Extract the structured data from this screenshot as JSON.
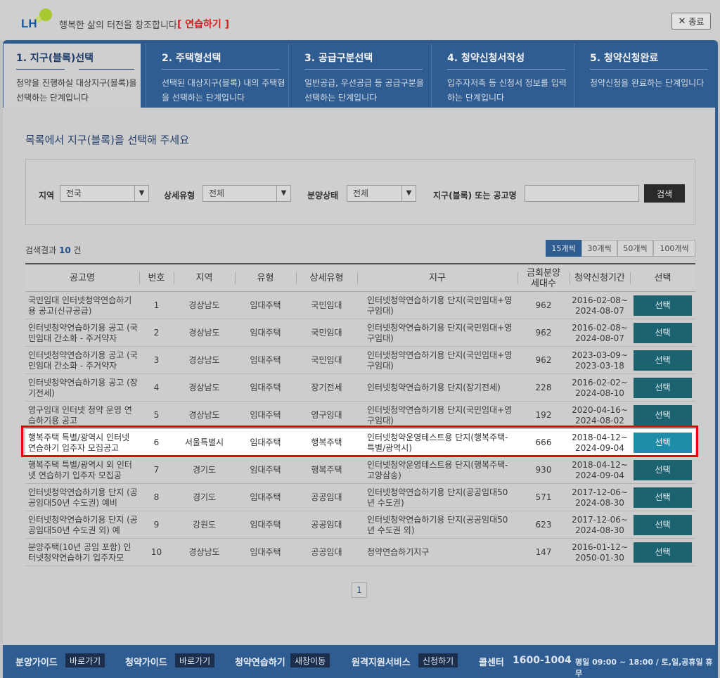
{
  "header": {
    "logo_text": "LH",
    "slogan": "행복한 삶의 터전을 창조합니다.",
    "practice_label": "[ 연습하기 ]",
    "close_label": "종료"
  },
  "steps": [
    {
      "title": "1. 지구(블록)선택",
      "desc": "청약을 진행하실 대상지구(블록)을 선택하는 단계입니다"
    },
    {
      "title": "2. 주택형선택",
      "desc": "선택된 대상지구(블록) 내의 주택형을 선택하는 단계입니다"
    },
    {
      "title": "3. 공급구분선택",
      "desc": "일반공급, 우선공급 등 공급구분을 선택하는 단계입니다"
    },
    {
      "title": "4. 청약신청서작성",
      "desc": "입주자저축 등 신청서 정보를 입력하는 단계입니다"
    },
    {
      "title": "5. 청약신청완료",
      "desc": "청약신청을 완료하는 단계입니다"
    }
  ],
  "main": {
    "heading": "목록에서 지구(블록)을 선택해 주세요"
  },
  "filters": {
    "region_label": "지역",
    "region_value": "전국",
    "detail_type_label": "상세유형",
    "detail_type_value": "전체",
    "sale_status_label": "분양상태",
    "sale_status_value": "전체",
    "keyword_label": "지구(블록) 또는 공고명",
    "keyword_value": "",
    "search_label": "검색"
  },
  "results": {
    "prefix": "검색결과",
    "count": "10",
    "suffix": "건"
  },
  "page_sizes": [
    "15개씩",
    "30개씩",
    "50개씩",
    "100개씩"
  ],
  "table": {
    "headers": [
      "공고명",
      "번호",
      "지역",
      "유형",
      "상세유형",
      "지구",
      "금회분양 세대수",
      "청약신청기간",
      "선택"
    ],
    "rows": [
      {
        "title": "국민임대 인터넷청약연습하기용 공고(신규공급)",
        "no": "1",
        "region": "경상남도",
        "type": "임대주택",
        "detail": "국민임대",
        "district": "인터넷청약연습하기용 단지(국민임대+영구임대)",
        "units": "962",
        "period": "2016-02-08~ 2024-08-07",
        "btn": "선택"
      },
      {
        "title": "인터넷청약연습하기용 공고 (국민임대 간소화 - 주거약자",
        "no": "2",
        "region": "경상남도",
        "type": "임대주택",
        "detail": "국민임대",
        "district": "인터넷청약연습하기용 단지(국민임대+영구임대)",
        "units": "962",
        "period": "2016-02-08~ 2024-08-07",
        "btn": "선택"
      },
      {
        "title": " 인터넷청약연습하기용 공고 (국민임대 간소화 - 주거약자",
        "no": "3",
        "region": "경상남도",
        "type": "임대주택",
        "detail": "국민임대",
        "district": "인터넷청약연습하기용 단지(국민임대+영구임대)",
        "units": "962",
        "period": "2023-03-09~ 2023-03-18",
        "btn": "선택"
      },
      {
        "title": "인터넷청약연습하기용 공고 (장기전세)",
        "no": "4",
        "region": "경상남도",
        "type": "임대주택",
        "detail": "장기전세",
        "district": "인터넷청약연습하기용 단지(장기전세)",
        "units": "228",
        "period": "2016-02-02~ 2024-08-10",
        "btn": "선택"
      },
      {
        "title": "영구임대 인터넷 청약 운영 연습하기용 공고",
        "no": "5",
        "region": "경상남도",
        "type": "임대주택",
        "detail": "영구임대",
        "district": "인터넷청약연습하기용 단지(국민임대+영구임대)",
        "units": "192",
        "period": "2020-04-16~ 2024-08-02",
        "btn": "선택"
      },
      {
        "title": "행복주택 특별/광역시 인터넷 연습하기 입주자 모집공고",
        "no": "6",
        "region": "서울특별시",
        "type": "임대주택",
        "detail": "행복주택",
        "district": "인터넷청약운영테스트용 단지(행복주택-특별/광역시)",
        "units": "666",
        "period": "2018-04-12~ 2024-09-04",
        "btn": "선택"
      },
      {
        "title": "행복주택 특별/광역시 외 인터넷 연습하기 입주자 모집공",
        "no": "7",
        "region": "경기도",
        "type": "임대주택",
        "detail": "행복주택",
        "district": "인터넷청약운영테스트용 단지(행복주택-고양삼송)",
        "units": "930",
        "period": "2018-04-12~ 2024-09-04",
        "btn": "선택"
      },
      {
        "title": "인터넷청약연습하기용 단지 (공공임대50년 수도권) 예비",
        "no": "8",
        "region": "경기도",
        "type": "임대주택",
        "detail": "공공임대",
        "district": "인터넷청약연습하기용 단지(공공임대50년 수도권)",
        "units": "571",
        "period": "2017-12-06~ 2024-08-30",
        "btn": "선택"
      },
      {
        "title": "인터넷청약연습하기용 단지 (공공임대50년 수도권 외) 예",
        "no": "9",
        "region": "강원도",
        "type": "임대주택",
        "detail": "공공임대",
        "district": "인터넷청약연습하기용 단지(공공임대50년 수도권 외)",
        "units": "623",
        "period": "2017-12-06~ 2024-08-30",
        "btn": "선택"
      },
      {
        "title": "분양주택(10년 공임 포함) 인터넷청약연습하기 입주자모",
        "no": "10",
        "region": "경상남도",
        "type": "임대주택",
        "detail": "공공임대",
        "district": "청약연습하기지구",
        "units": "147",
        "period": "2016-01-12~ 2050-01-30",
        "btn": "선택"
      }
    ]
  },
  "pagination": {
    "current": "1"
  },
  "footer": {
    "guide1_label": "분양가이드",
    "guide1_btn": "바로가기",
    "guide2_label": "청약가이드",
    "guide2_btn": "바로가기",
    "practice_label": "청약연습하기",
    "practice_btn": "새창이동",
    "remote_label": "원격지원서비스",
    "remote_btn": "신청하기",
    "call_label": "콜센터",
    "call_number": "1600-1004",
    "hours": "평일 09:00 ~ 18:00 / 토,일,공휴일 휴무"
  },
  "colors": {
    "brand_blue": "#2f5c91",
    "select_button": "#1c6372",
    "select_button_highlight": "#1e8ea8",
    "highlight_border": "#e00000",
    "practice_red": "#d81c1c"
  },
  "icons": {
    "close": "close-x-icon",
    "dropdown": "chevron-down-icon"
  }
}
